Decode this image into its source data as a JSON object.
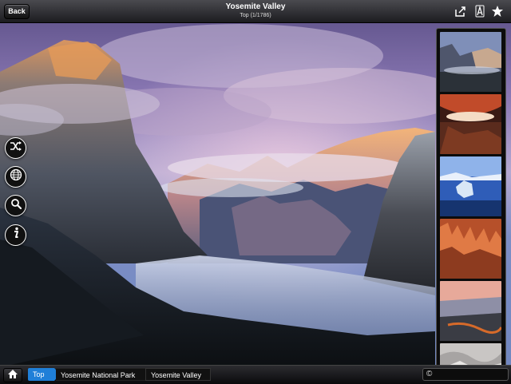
{
  "header": {
    "back_label": "Back",
    "title": "Yosemite Valley",
    "subtitle": "Top (1/1786)"
  },
  "icons": {
    "share": "share-icon",
    "text_size": "font-icon",
    "favorite": "star-icon",
    "shuffle": "shuffle-icon",
    "globe": "globe-icon",
    "search": "search-icon",
    "info": "info-icon",
    "home": "home-icon"
  },
  "breadcrumb": {
    "items": [
      "Top",
      "Yosemite National Park",
      "Yosemite Valley"
    ]
  },
  "footer": {
    "copyright_symbol": "©"
  },
  "colors": {
    "accent": "#1f7fd8",
    "bar_dark": "#1c1c20"
  }
}
